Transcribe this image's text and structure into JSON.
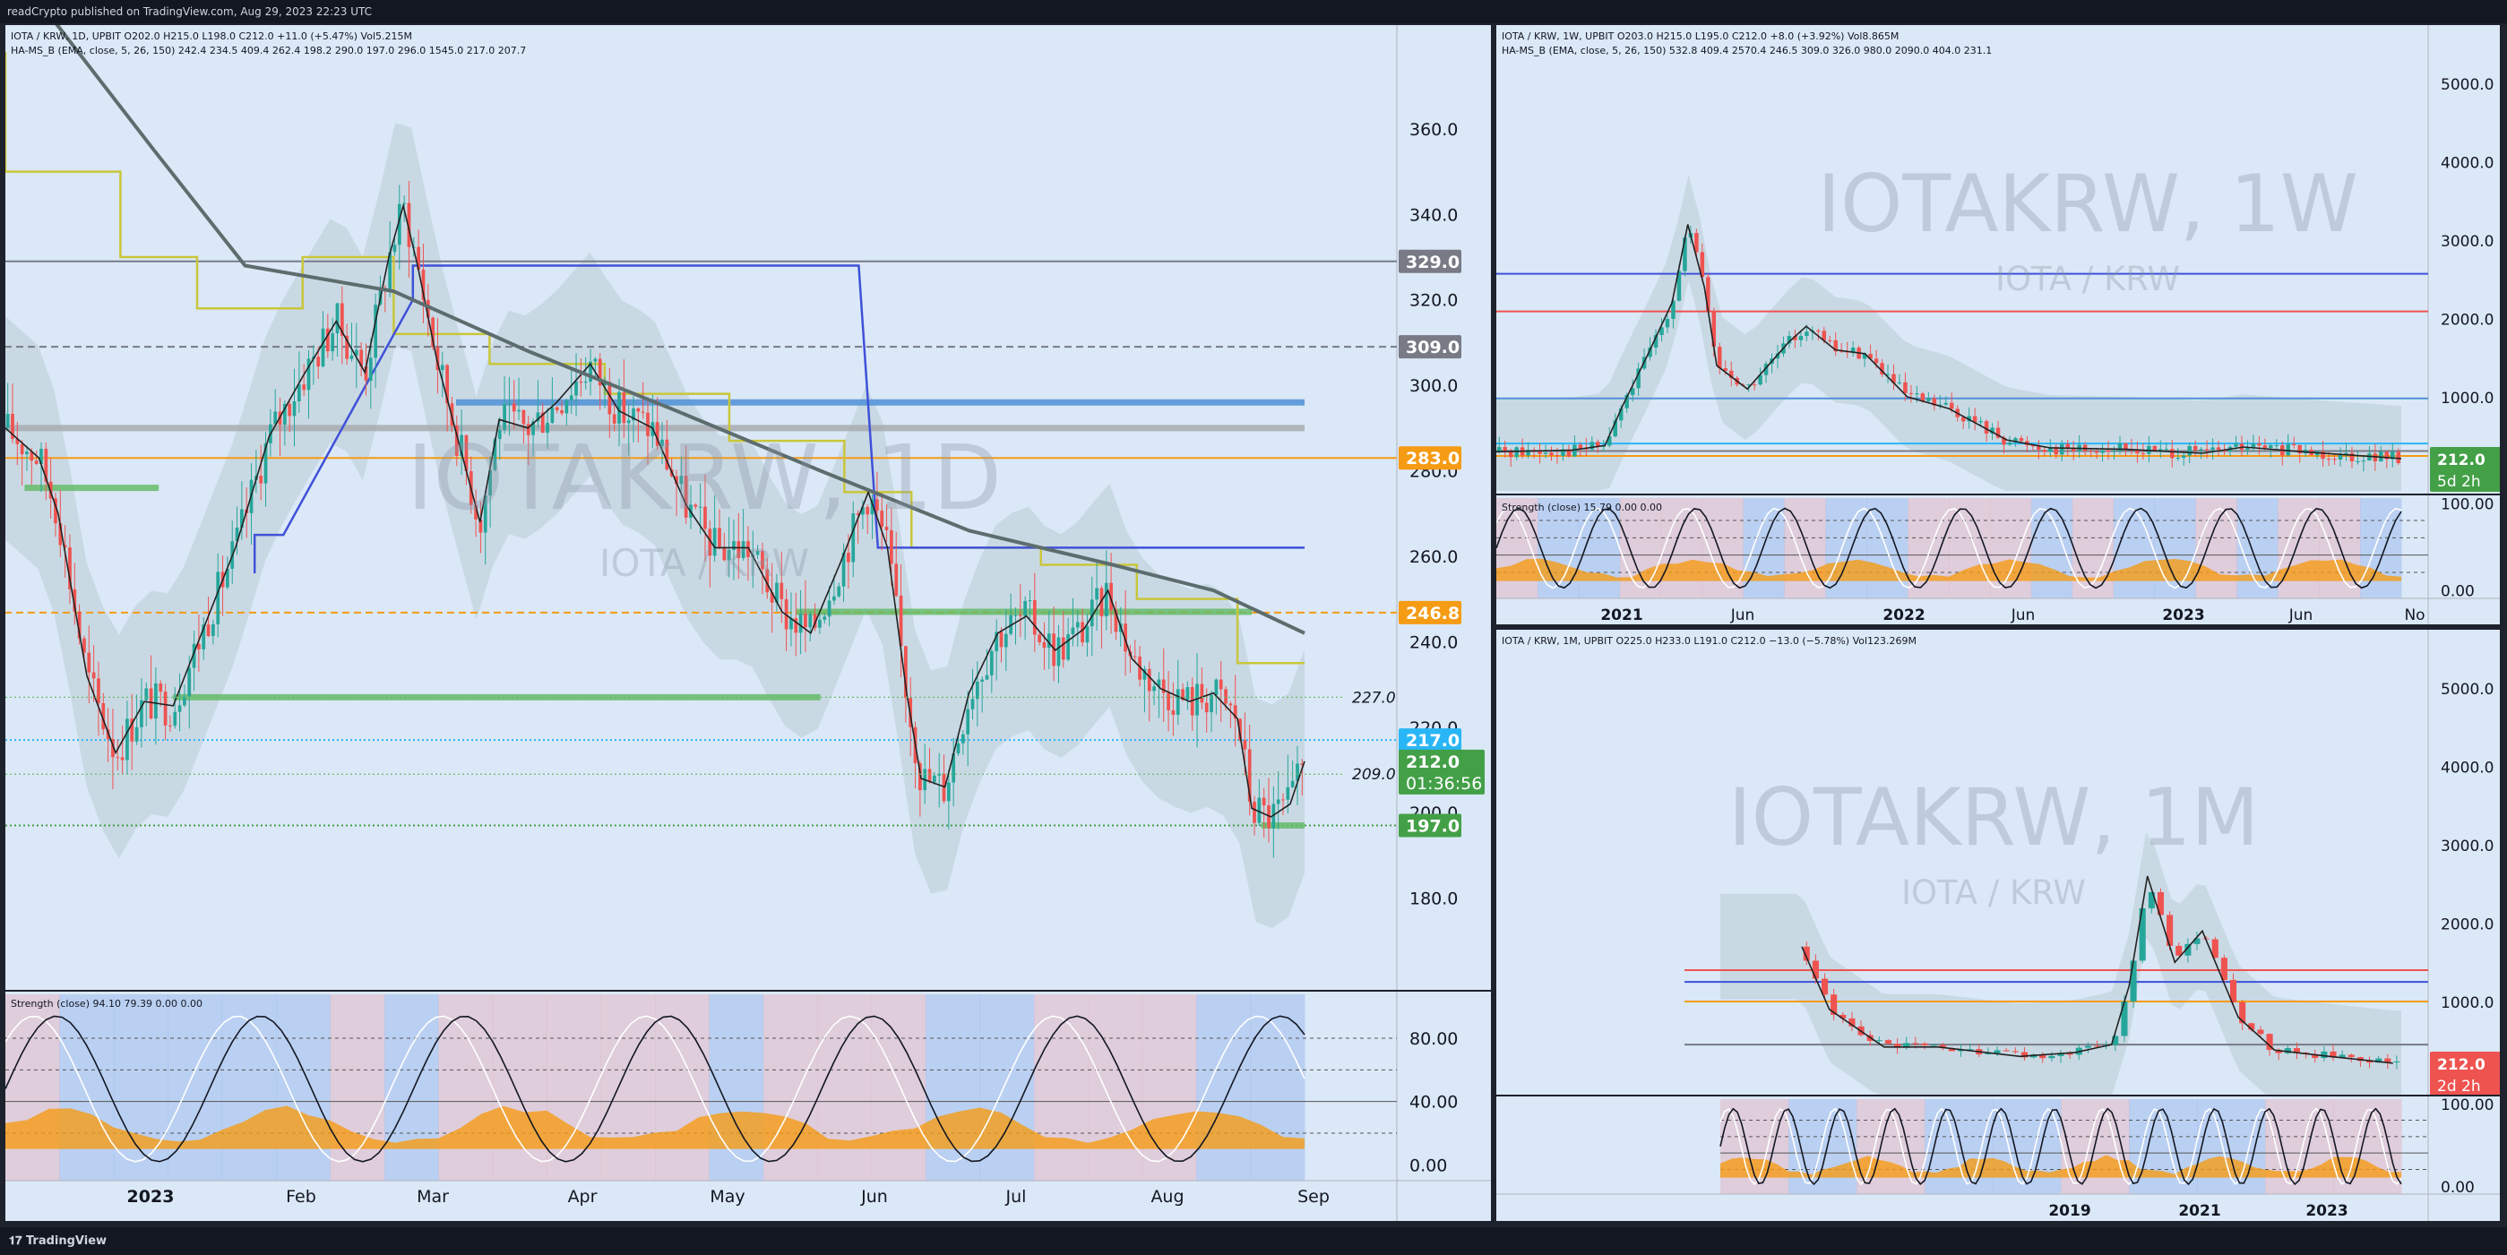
{
  "header": {
    "published": "readCrypto published on TradingView.com, Aug 29, 2023 22:23 UTC"
  },
  "footer": {
    "brand": "TradingView"
  },
  "colors": {
    "bg": "#dbe8f7",
    "frame": "#1e222d",
    "orange": "#f59b14",
    "green_label": "#43a047",
    "teal_label": "#29b6f6",
    "gray_label": "#787b86",
    "red_label": "#ef5350",
    "blue_line": "#3f51d8",
    "sma_gray": "#5d6d6e",
    "yellow_line": "#c9c63a"
  },
  "chart_data": [
    {
      "id": "daily",
      "type": "candlestick",
      "legend_main": "IOTA / KRW, 1D, UPBIT  O202.0  H215.0  L198.0  C212.0  +11.0 (+5.47%)  Vol5.215M",
      "legend_ind": "HA-MS_B (EMA, close, 5, 26, 150)  242.4  234.5  409.4  262.4  198.2  290.0  197.0  296.0  1545.0  217.0  207.7",
      "watermark": "IOTAKRW, 1D",
      "watermark_sub": "IOTA / KRW",
      "ylim": [
        160,
        378
      ],
      "y_ticks": [
        "180.0",
        "200.0",
        "220.0",
        "240.0",
        "260.0",
        "280.0",
        "300.0",
        "320.0",
        "340.0",
        "360.0"
      ],
      "x_ticks": [
        "2023",
        "Feb",
        "Mar",
        "Apr",
        "May",
        "Jun",
        "Jul",
        "Aug",
        "Sep"
      ],
      "price_labels": [
        {
          "value": 329.0,
          "text": "329.0",
          "color": "#787b86"
        },
        {
          "value": 309.0,
          "text": "309.0",
          "color": "#787b86"
        },
        {
          "value": 283.0,
          "text": "283.0",
          "color": "#f59b14"
        },
        {
          "value": 246.8,
          "text": "246.8",
          "color": "#f59b14"
        },
        {
          "value": 217.0,
          "text": "217.0",
          "color": "#29b6f6"
        },
        {
          "value": 212.0,
          "text": "212.0",
          "sub": "01:36:56",
          "color": "#43a047"
        },
        {
          "value": 197.0,
          "text": "197.0",
          "color": "#43a047"
        }
      ],
      "line_labels": [
        {
          "value": 227.0,
          "text": "227.0"
        },
        {
          "value": 209.0,
          "text": "209.0"
        }
      ],
      "close_path": [
        [
          "2022-12-01",
          290
        ],
        [
          "2022-12-08",
          283
        ],
        [
          "2022-12-12",
          270
        ],
        [
          "2022-12-18",
          232
        ],
        [
          "2022-12-24",
          214
        ],
        [
          "2022-12-30",
          226
        ],
        [
          "2023-01-05",
          225
        ],
        [
          "2023-01-12",
          245
        ],
        [
          "2023-01-18",
          262
        ],
        [
          "2023-01-25",
          288
        ],
        [
          "2023-02-01",
          302
        ],
        [
          "2023-02-08",
          315
        ],
        [
          "2023-02-14",
          303
        ],
        [
          "2023-02-19",
          330
        ],
        [
          "2023-02-22",
          342
        ],
        [
          "2023-02-25",
          328
        ],
        [
          "2023-03-01",
          306
        ],
        [
          "2023-03-05",
          289
        ],
        [
          "2023-03-10",
          268
        ],
        [
          "2023-03-14",
          292
        ],
        [
          "2023-03-20",
          290
        ],
        [
          "2023-03-26",
          296
        ],
        [
          "2023-04-02",
          305
        ],
        [
          "2023-04-08",
          294
        ],
        [
          "2023-04-15",
          290
        ],
        [
          "2023-04-22",
          272
        ],
        [
          "2023-04-28",
          262
        ],
        [
          "2023-05-05",
          262
        ],
        [
          "2023-05-12",
          247
        ],
        [
          "2023-05-18",
          242
        ],
        [
          "2023-05-24",
          258
        ],
        [
          "2023-05-30",
          275
        ],
        [
          "2023-06-03",
          262
        ],
        [
          "2023-06-07",
          228
        ],
        [
          "2023-06-10",
          208
        ],
        [
          "2023-06-15",
          206
        ],
        [
          "2023-06-20",
          228
        ],
        [
          "2023-06-26",
          242
        ],
        [
          "2023-07-02",
          246
        ],
        [
          "2023-07-08",
          238
        ],
        [
          "2023-07-14",
          243
        ],
        [
          "2023-07-19",
          252
        ],
        [
          "2023-07-24",
          236
        ],
        [
          "2023-07-30",
          229
        ],
        [
          "2023-08-05",
          226
        ],
        [
          "2023-08-10",
          228
        ],
        [
          "2023-08-15",
          222
        ],
        [
          "2023-08-18",
          201
        ],
        [
          "2023-08-22",
          199
        ],
        [
          "2023-08-26",
          202
        ],
        [
          "2023-08-29",
          212
        ]
      ],
      "sma_line": [
        [
          "2022-12-01",
          400
        ],
        [
          "2023-01-01",
          355
        ],
        [
          "2023-01-20",
          328
        ],
        [
          "2023-02-20",
          322
        ],
        [
          "2023-03-20",
          308
        ],
        [
          "2023-04-20",
          294
        ],
        [
          "2023-05-20",
          280
        ],
        [
          "2023-06-20",
          266
        ],
        [
          "2023-07-20",
          258
        ],
        [
          "2023-08-10",
          252
        ],
        [
          "2023-08-29",
          242
        ]
      ],
      "step_line": [
        [
          "2022-12-01",
          378
        ],
        [
          "2022-12-25",
          350
        ],
        [
          "2023-01-10",
          330
        ],
        [
          "2023-02-01",
          318
        ],
        [
          "2023-02-20",
          330
        ],
        [
          "2023-03-12",
          312
        ],
        [
          "2023-04-05",
          305
        ],
        [
          "2023-05-01",
          298
        ],
        [
          "2023-05-25",
          287
        ],
        [
          "2023-06-08",
          275
        ],
        [
          "2023-07-05",
          262
        ],
        [
          "2023-07-25",
          258
        ],
        [
          "2023-08-15",
          250
        ],
        [
          "2023-08-29",
          235
        ]
      ],
      "blue_step": [
        [
          "2023-01-22",
          256
        ],
        [
          "2023-01-22",
          265
        ],
        [
          "2023-01-28",
          265
        ],
        [
          "2023-02-24",
          320
        ],
        [
          "2023-02-24",
          328
        ],
        [
          "2023-05-28",
          328
        ],
        [
          "2023-06-01",
          262
        ],
        [
          "2023-08-29",
          262
        ]
      ],
      "hlines": [
        {
          "value": 329.0,
          "color": "#787b86",
          "style": "solid"
        },
        {
          "value": 309.0,
          "color": "#787b86",
          "style": "dashed"
        },
        {
          "value": 283.0,
          "color": "#f59b14",
          "style": "solid"
        },
        {
          "value": 246.8,
          "color": "#f59b14",
          "style": "dashed"
        },
        {
          "value": 217.0,
          "color": "#29b6f6",
          "style": "dotted"
        },
        {
          "value": 197.0,
          "color": "#43a047",
          "style": "dotted"
        }
      ],
      "zones": [
        {
          "from": "2023-03-05",
          "to": "2023-08-29",
          "value": 296,
          "color": "#4f8fd6"
        },
        {
          "from": "2022-12-01",
          "to": "2023-08-29",
          "value": 290,
          "color": "#a8aab0"
        },
        {
          "from": "2023-01-05",
          "to": "2023-05-20",
          "value": 227,
          "color": "#66bb6a"
        },
        {
          "from": "2023-05-15",
          "to": "2023-08-18",
          "value": 247,
          "color": "#66bb6a"
        },
        {
          "from": "2022-12-05",
          "to": "2023-01-02",
          "value": 276,
          "color": "#66bb6a"
        },
        {
          "from": "2023-08-20",
          "to": "2023-08-29",
          "value": 197,
          "color": "#66bb6a"
        }
      ],
      "oscillator": {
        "title": "Strength (close)",
        "values": [
          "94.10",
          "79.39",
          "0.00",
          "0.00"
        ],
        "ylim": [
          -10,
          110
        ],
        "y_ticks": [
          "0.00",
          "40.00",
          "80.00"
        ]
      }
    },
    {
      "id": "weekly",
      "type": "candlestick",
      "legend_main": "IOTA / KRW, 1W, UPBIT  O203.0  H215.0  L195.0  C212.0  +8.0 (+3.92%)  Vol8.865M",
      "legend_ind": "HA-MS_B (EMA, close, 5, 26, 150)  532.8  409.4  2570.4  246.5  309.0  326.0  980.0  2090.0  404.0  231.1",
      "watermark": "IOTAKRW, 1W",
      "watermark_sub": "IOTA / KRW",
      "ylim": [
        -200,
        5400
      ],
      "y_ticks": [
        "1000.0",
        "2000.0",
        "3000.0",
        "4000.0",
        "5000.0"
      ],
      "x_ticks": [
        "2021",
        "Jun",
        "2022",
        "Jun",
        "2023",
        "Jun",
        "No"
      ],
      "price_labels": [
        {
          "value": 212.0,
          "text": "212.0",
          "sub": "5d 2h",
          "color": "#43a047"
        }
      ],
      "close_path": [
        [
          "2020-09-01",
          300
        ],
        [
          "2020-12-01",
          320
        ],
        [
          "2021-01-10",
          380
        ],
        [
          "2021-02-01",
          900
        ],
        [
          "2021-03-01",
          1500
        ],
        [
          "2021-04-01",
          2200
        ],
        [
          "2021-04-20",
          3200
        ],
        [
          "2021-05-10",
          2400
        ],
        [
          "2021-05-25",
          1400
        ],
        [
          "2021-07-01",
          1100
        ],
        [
          "2021-08-20",
          1700
        ],
        [
          "2021-09-10",
          1900
        ],
        [
          "2021-10-15",
          1600
        ],
        [
          "2021-11-20",
          1550
        ],
        [
          "2022-01-10",
          1000
        ],
        [
          "2022-03-01",
          850
        ],
        [
          "2022-05-10",
          450
        ],
        [
          "2022-07-01",
          350
        ],
        [
          "2022-10-01",
          330
        ],
        [
          "2023-01-01",
          280
        ],
        [
          "2023-02-20",
          360
        ],
        [
          "2023-05-01",
          300
        ],
        [
          "2023-08-29",
          212
        ]
      ],
      "hlines": [
        {
          "value": 2570,
          "color": "#3f51d8"
        },
        {
          "value": 2090,
          "color": "#ef5350"
        },
        {
          "value": 980,
          "color": "#4f8fd6"
        },
        {
          "value": 404,
          "color": "#29b6f6"
        },
        {
          "value": 309,
          "color": "#787b86"
        },
        {
          "value": 246,
          "color": "#f59b14"
        }
      ],
      "oscillator": {
        "title": "Strength (close)",
        "values": [
          "15.79",
          "0.00",
          "0.00"
        ],
        "y_ticks": [
          "0.00",
          "100.00"
        ]
      }
    },
    {
      "id": "monthly",
      "type": "candlestick",
      "legend_main": "IOTA / KRW, 1M, UPBIT  O225.0  H233.0  L191.0  C212.0  −13.0 (−5.78%)  Vol123.269M",
      "watermark": "IOTAKRW, 1M",
      "watermark_sub": "IOTA / KRW",
      "ylim": [
        -200,
        5400
      ],
      "y_ticks": [
        "1000.0",
        "2000.0",
        "3000.0",
        "4000.0",
        "5000.0"
      ],
      "x_ticks": [
        "2019",
        "2021",
        "2023"
      ],
      "price_labels": [
        {
          "value": 212.0,
          "text": "212.0",
          "sub": "2d 2h",
          "color": "#ef5350"
        }
      ],
      "close_path": [
        [
          "2018-03-01",
          1700
        ],
        [
          "2018-06-01",
          900
        ],
        [
          "2018-12-01",
          420
        ],
        [
          "2019-06-01",
          420
        ],
        [
          "2020-03-01",
          300
        ],
        [
          "2020-09-01",
          350
        ],
        [
          "2021-01-01",
          450
        ],
        [
          "2021-03-01",
          1200
        ],
        [
          "2021-05-01",
          2600
        ],
        [
          "2021-08-01",
          1500
        ],
        [
          "2021-11-01",
          1900
        ],
        [
          "2022-03-01",
          800
        ],
        [
          "2022-07-01",
          380
        ],
        [
          "2023-01-01",
          300
        ],
        [
          "2023-08-01",
          212
        ]
      ],
      "hlines": [
        {
          "value": 1400,
          "color": "#ef5350"
        },
        {
          "value": 1250,
          "color": "#3f51d8"
        },
        {
          "value": 1000,
          "color": "#f59b14"
        },
        {
          "value": 450,
          "color": "#787b86"
        }
      ],
      "oscillator": {
        "y_ticks": [
          "0.00",
          "100.00"
        ]
      }
    }
  ]
}
